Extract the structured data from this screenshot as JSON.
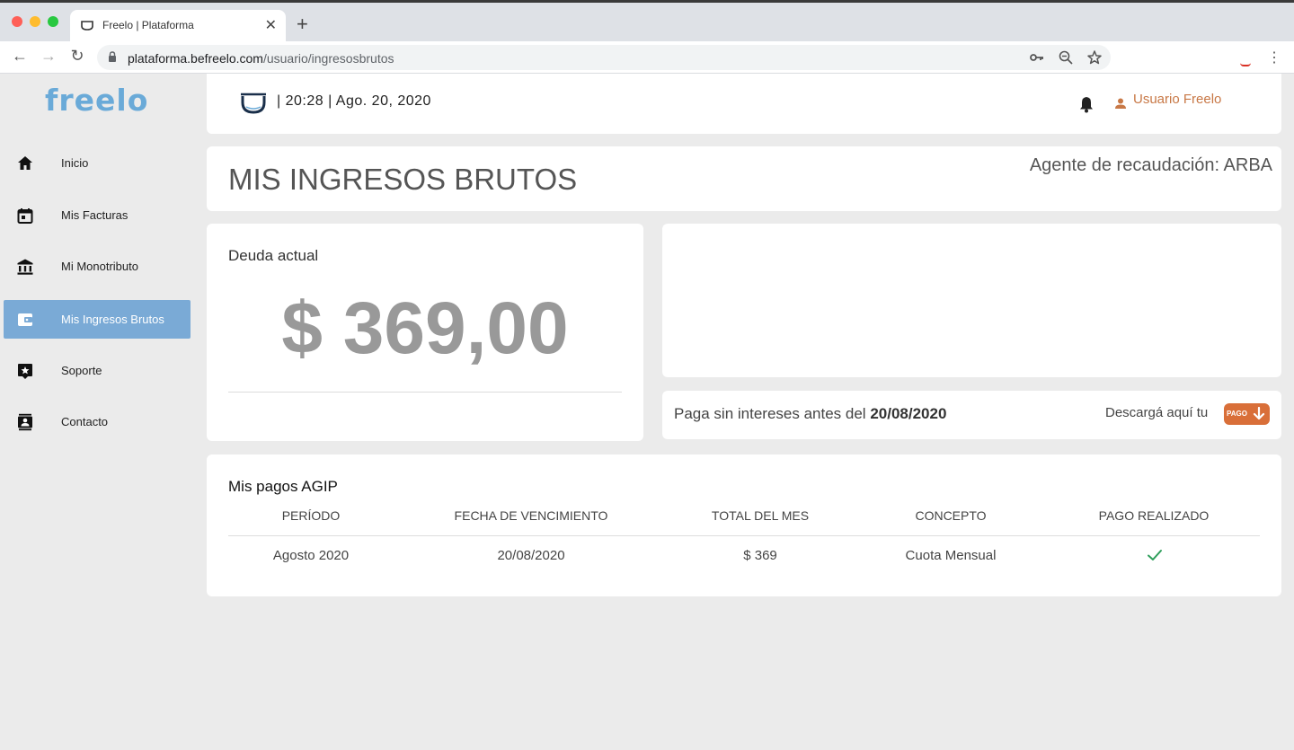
{
  "browser": {
    "tab_title": "Freelo | Plataforma",
    "tab_close": "✕",
    "new_tab": "+",
    "url_host": "plataforma.befreelo.com",
    "url_path": "/usuario/ingresosbrutos",
    "back": "←",
    "forward": "→",
    "reload": "↻",
    "menu": "⋮"
  },
  "sidebar": {
    "logo": "freelo",
    "items": [
      {
        "label": "Inicio",
        "icon": "home-icon"
      },
      {
        "label": "Mis Facturas",
        "icon": "calendar-icon"
      },
      {
        "label": "Mi Monotributo",
        "icon": "bank-icon"
      },
      {
        "label": "Mis Ingresos Brutos",
        "icon": "wallet-icon",
        "active": true
      },
      {
        "label": "Soporte",
        "icon": "support-icon"
      },
      {
        "label": "Contacto",
        "icon": "contact-icon"
      }
    ]
  },
  "header": {
    "datetime": "|  20:28  |  Ago. 20, 2020",
    "user": "Usuario Freelo"
  },
  "page": {
    "title": "MIS INGRESOS BRUTOS",
    "agente": "Agente de recaudación: ARBA"
  },
  "deuda": {
    "label": "Deuda actual",
    "amount": "$ 369,00"
  },
  "pago": {
    "text_prefix": "Paga sin intereses antes del ",
    "date": "20/08/2020",
    "descarga": "Descargá aquí tu",
    "button": "PAGO"
  },
  "pagos": {
    "title": "Mis pagos AGIP",
    "columns": [
      "PERÍODO",
      "FECHA DE VENCIMIENTO",
      "TOTAL DEL MES",
      "CONCEPTO",
      "PAGO REALIZADO"
    ],
    "rows": [
      {
        "periodo": "Agosto 2020",
        "vencimiento": "20/08/2020",
        "total": "$ 369",
        "concepto": "Cuota Mensual",
        "pagado": true
      }
    ]
  },
  "colors": {
    "accent": "#7aaad6",
    "logo": "#6aaad8",
    "user": "#c87846",
    "pago_button": "#d96f39",
    "check": "#2e9e5b"
  }
}
